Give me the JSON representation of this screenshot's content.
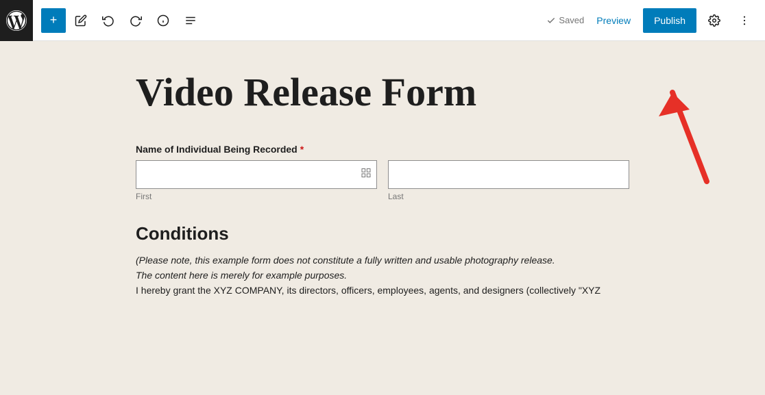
{
  "toolbar": {
    "wp_logo_aria": "WordPress",
    "add_label": "+",
    "undo_label": "↩",
    "redo_label": "↪",
    "info_label": "ℹ",
    "list_view_label": "≡",
    "saved_label": "Saved",
    "preview_label": "Preview",
    "publish_label": "Publish",
    "settings_label": "⚙",
    "more_label": "⋮"
  },
  "page": {
    "title": "Video Release Form",
    "form": {
      "name_label": "Name of Individual Being Recorded",
      "required_marker": "*",
      "first_sublabel": "First",
      "last_sublabel": "Last",
      "first_placeholder": "",
      "last_placeholder": ""
    },
    "conditions": {
      "title": "Conditions",
      "text_line1": "(Please note, this example form does not constitute a fully written and usable photography release.",
      "text_line2": "The content here is merely for example purposes.",
      "text_line3": "I hereby grant the XYZ COMPANY, its directors, officers, employees, agents, and designers (collectively \"XYZ"
    }
  }
}
